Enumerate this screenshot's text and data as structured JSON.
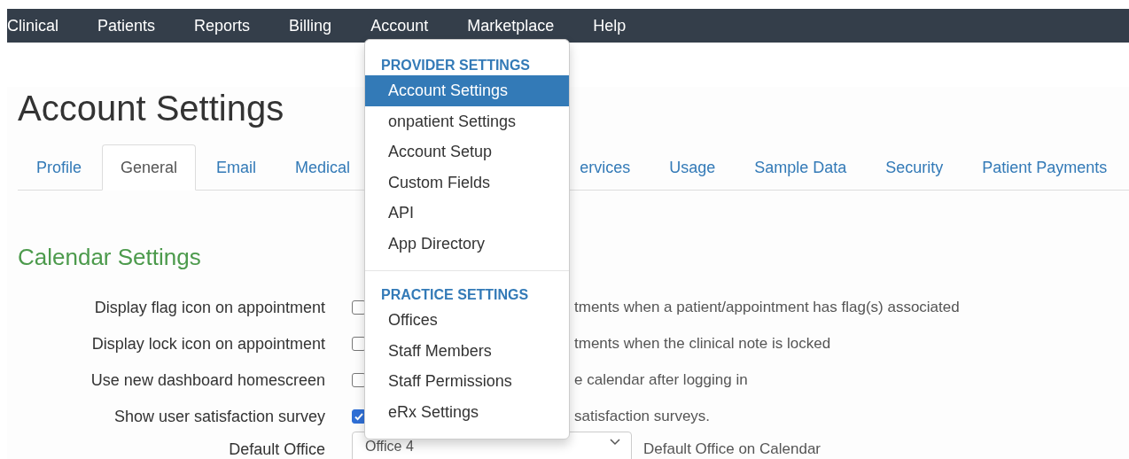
{
  "nav": {
    "items": [
      {
        "label": "Clinical"
      },
      {
        "label": "Patients"
      },
      {
        "label": "Reports"
      },
      {
        "label": "Billing"
      },
      {
        "label": "Account"
      },
      {
        "label": "Marketplace"
      },
      {
        "label": "Help"
      }
    ]
  },
  "page_title": "Account Settings",
  "tabs": [
    {
      "label": "Profile",
      "selected": false
    },
    {
      "label": "General",
      "selected": true
    },
    {
      "label": "Email",
      "selected": false
    },
    {
      "label": "Medical",
      "selected": false
    },
    {
      "label": "ervices",
      "selected": false
    },
    {
      "label": "Usage",
      "selected": false
    },
    {
      "label": "Sample Data",
      "selected": false
    },
    {
      "label": "Security",
      "selected": false
    },
    {
      "label": "Patient Payments",
      "selected": false
    }
  ],
  "section_title": "Calendar Settings",
  "settings": [
    {
      "label": "Display flag icon on appointment",
      "checked": false,
      "help": "tments when a patient/appointment has flag(s) associated"
    },
    {
      "label": "Display lock icon on appointment",
      "checked": false,
      "help": "tments when the clinical note is locked"
    },
    {
      "label": "Use new dashboard homescreen",
      "checked": false,
      "help": "e calendar after logging in"
    },
    {
      "label": "Show user satisfaction survey",
      "checked": true,
      "help": "satisfaction surveys."
    }
  ],
  "default_office": {
    "label": "Default Office",
    "value": "Office 4",
    "help": "Default Office on Calendar"
  },
  "account_menu": {
    "sections": [
      {
        "title": "PROVIDER SETTINGS",
        "items": [
          {
            "label": "Account Settings",
            "selected": true
          },
          {
            "label": "onpatient Settings",
            "selected": false
          },
          {
            "label": "Account Setup",
            "selected": false
          },
          {
            "label": "Custom Fields",
            "selected": false
          },
          {
            "label": "API",
            "selected": false
          },
          {
            "label": "App Directory",
            "selected": false
          }
        ]
      },
      {
        "title": "PRACTICE SETTINGS",
        "items": [
          {
            "label": "Offices",
            "selected": false
          },
          {
            "label": "Staff Members",
            "selected": false
          },
          {
            "label": "Staff Permissions",
            "selected": false
          },
          {
            "label": "eRx Settings",
            "selected": false
          }
        ]
      }
    ]
  }
}
